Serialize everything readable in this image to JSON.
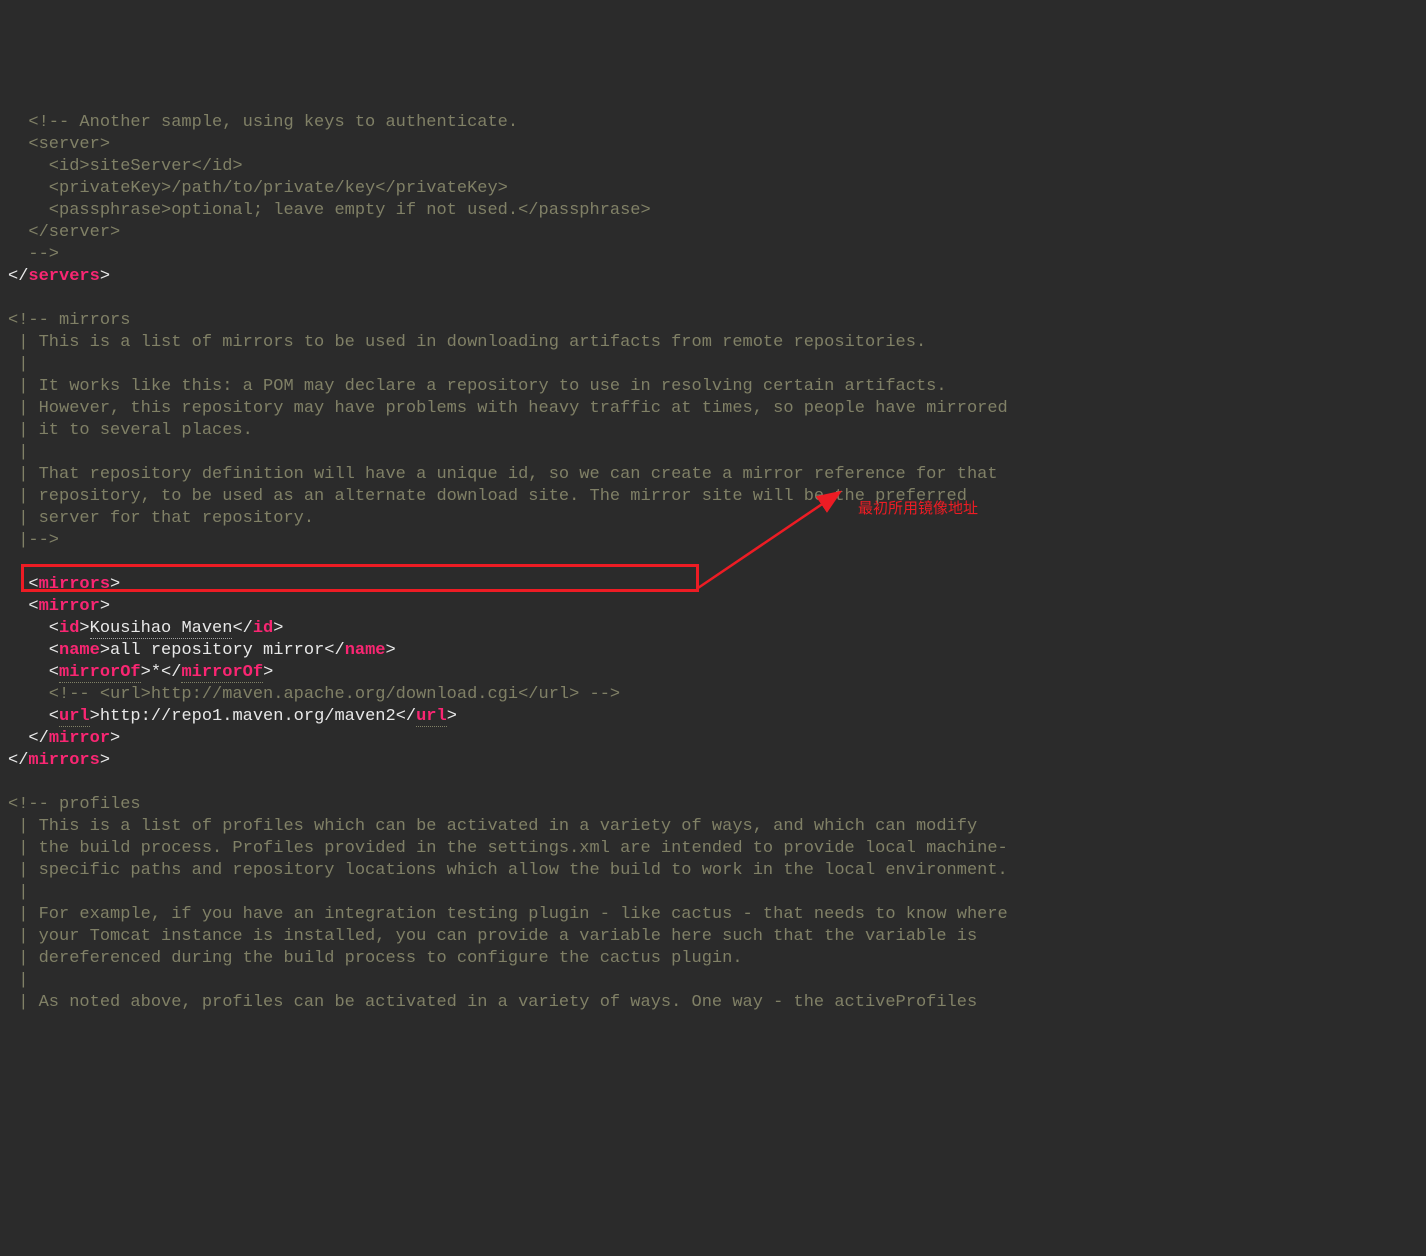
{
  "code": {
    "comment_block_1": {
      "line1": "  <!-- Another sample, using keys to authenticate.",
      "line2": "  <server>",
      "line3": "    <id>siteServer</id>",
      "line4": "    <privateKey>/path/to/private/key</privateKey>",
      "line5": "    <passphrase>optional; leave empty if not used.</passphrase>",
      "line6": "  </server>",
      "line7": "  -->"
    },
    "servers_close": {
      "bracket_open": "</",
      "tag": "servers",
      "bracket_close": ">"
    },
    "mirrors_comment": {
      "l01": "<!-- mirrors",
      "l02": " | This is a list of mirrors to be used in downloading artifacts from remote repositories.",
      "l03": " |",
      "l04": " | It works like this: a POM may declare a repository to use in resolving certain artifacts.",
      "l05": " | However, this repository may have problems with heavy traffic at times, so people have mirrored",
      "l06": " | it to several places.",
      "l07": " |",
      "l08": " | That repository definition will have a unique id, so we can create a mirror reference for that",
      "l09": " | repository, to be used as an alternate download site. The mirror site will be the preferred",
      "l10": " | server for that repository.",
      "l11": " |-->"
    },
    "mirrors_block": {
      "mirrors_open": {
        "pre": "  <",
        "tag": "mirrors",
        "post": ">"
      },
      "mirror_open": {
        "pre": "  <",
        "tag": "mirror",
        "post": ">"
      },
      "id": {
        "pre": "    <",
        "tag": "id",
        "mid": ">",
        "val": "Kousihao Maven",
        "closepre": "</",
        "closepost": ">"
      },
      "name": {
        "pre": "    <",
        "tag": "name",
        "mid": ">",
        "val": "all repository mirror",
        "closepre": "</",
        "closepost": ">"
      },
      "mirrorOf": {
        "pre": "    <",
        "tag": "mirrorOf",
        "mid": ">",
        "val": "*",
        "closepre": "</",
        "closepost": ">"
      },
      "commented_url": "    <!-- <url>http://maven.apache.org/download.cgi</url> -->",
      "url": {
        "pre": "    <",
        "tag": "url",
        "mid": ">",
        "val": "http://repo1.maven.org/maven2",
        "closepre": "</",
        "closepost": ">"
      },
      "mirror_close": {
        "pre": "  </",
        "tag": "mirror",
        "post": ">"
      },
      "mirrors_close": {
        "pre": "</",
        "tag": "mirrors",
        "post": ">"
      }
    },
    "profiles_comment": {
      "l01": "<!-- profiles",
      "l02": " | This is a list of profiles which can be activated in a variety of ways, and which can modify",
      "l03": " | the build process. Profiles provided in the settings.xml are intended to provide local machine-",
      "l04": " | specific paths and repository locations which allow the build to work in the local environment.",
      "l05": " |",
      "l06": " | For example, if you have an integration testing plugin - like cactus - that needs to know where",
      "l07": " | your Tomcat instance is installed, you can provide a variable here such that the variable is",
      "l08": " | dereferenced during the build process to configure the cactus plugin.",
      "l09": " |",
      "l10": " | As noted above, profiles can be activated in a variety of ways. One way - the activeProfiles"
    }
  },
  "annotation": {
    "label": "最初所用镜像地址"
  }
}
